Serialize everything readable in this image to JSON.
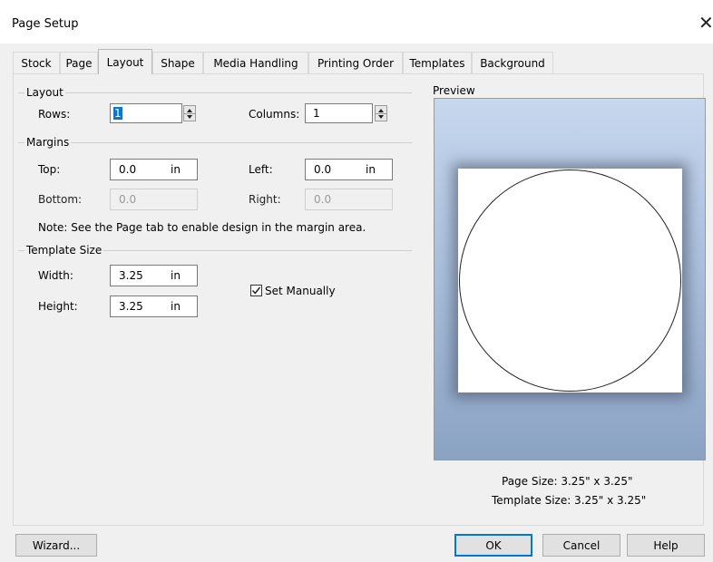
{
  "window": {
    "title": "Page Setup",
    "close_glyph": "✕"
  },
  "tabs": [
    {
      "label": "Stock"
    },
    {
      "label": "Page"
    },
    {
      "label": "Layout",
      "active": true
    },
    {
      "label": "Shape"
    },
    {
      "label": "Media Handling"
    },
    {
      "label": "Printing Order"
    },
    {
      "label": "Templates"
    },
    {
      "label": "Background"
    }
  ],
  "layout_section": {
    "title": "Layout",
    "rows_label": "Rows:",
    "rows_value": "1",
    "columns_label": "Columns:",
    "columns_value": "1"
  },
  "margins_section": {
    "title": "Margins",
    "top_label": "Top:",
    "top_value": "0.0",
    "top_unit": "in",
    "left_label": "Left:",
    "left_value": "0.0",
    "left_unit": "in",
    "bottom_label": "Bottom:",
    "bottom_value": "0.0",
    "right_label": "Right:",
    "right_value": "0.0",
    "note": "Note: See the Page tab to enable design in the margin area."
  },
  "template_section": {
    "title": "Template Size",
    "width_label": "Width:",
    "width_value": "3.25",
    "width_unit": "in",
    "height_label": "Height:",
    "height_value": "3.25",
    "height_unit": "in",
    "set_manually_label": "Set Manually",
    "set_manually_checked": true
  },
  "preview": {
    "title": "Preview",
    "page_size_text": "Page Size:  3.25\" x 3.25\"",
    "template_size_text": "Template Size:  3.25\" x 3.25\""
  },
  "buttons": {
    "wizard": "Wizard...",
    "ok": "OK",
    "cancel": "Cancel",
    "help": "Help"
  },
  "colors": {
    "accent": "#0078d7",
    "preview_top": "#c6d7ee",
    "preview_bottom": "#8ba3c3"
  }
}
